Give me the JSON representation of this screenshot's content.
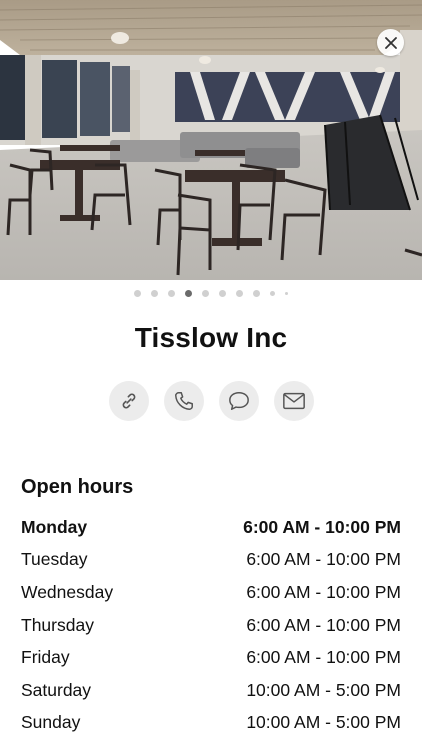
{
  "business": {
    "name": "Tisslow Inc"
  },
  "hero": {
    "pager_count": 10,
    "active_index": 3
  },
  "actions": [
    {
      "icon": "link-icon"
    },
    {
      "icon": "phone-icon"
    },
    {
      "icon": "message-icon"
    },
    {
      "icon": "mail-icon"
    }
  ],
  "hours": {
    "title": "Open hours",
    "days": [
      {
        "day": "Monday",
        "time": "6:00 AM - 10:00 PM"
      },
      {
        "day": "Tuesday",
        "time": "6:00 AM - 10:00 PM"
      },
      {
        "day": "Wednesday",
        "time": "6:00 AM - 10:00 PM"
      },
      {
        "day": "Thursday",
        "time": "6:00 AM - 10:00 PM"
      },
      {
        "day": "Friday",
        "time": "6:00 AM - 10:00 PM"
      },
      {
        "day": "Saturday",
        "time": "10:00 AM - 5:00 PM"
      },
      {
        "day": "Sunday",
        "time": "10:00 AM - 5:00 PM"
      }
    ]
  }
}
